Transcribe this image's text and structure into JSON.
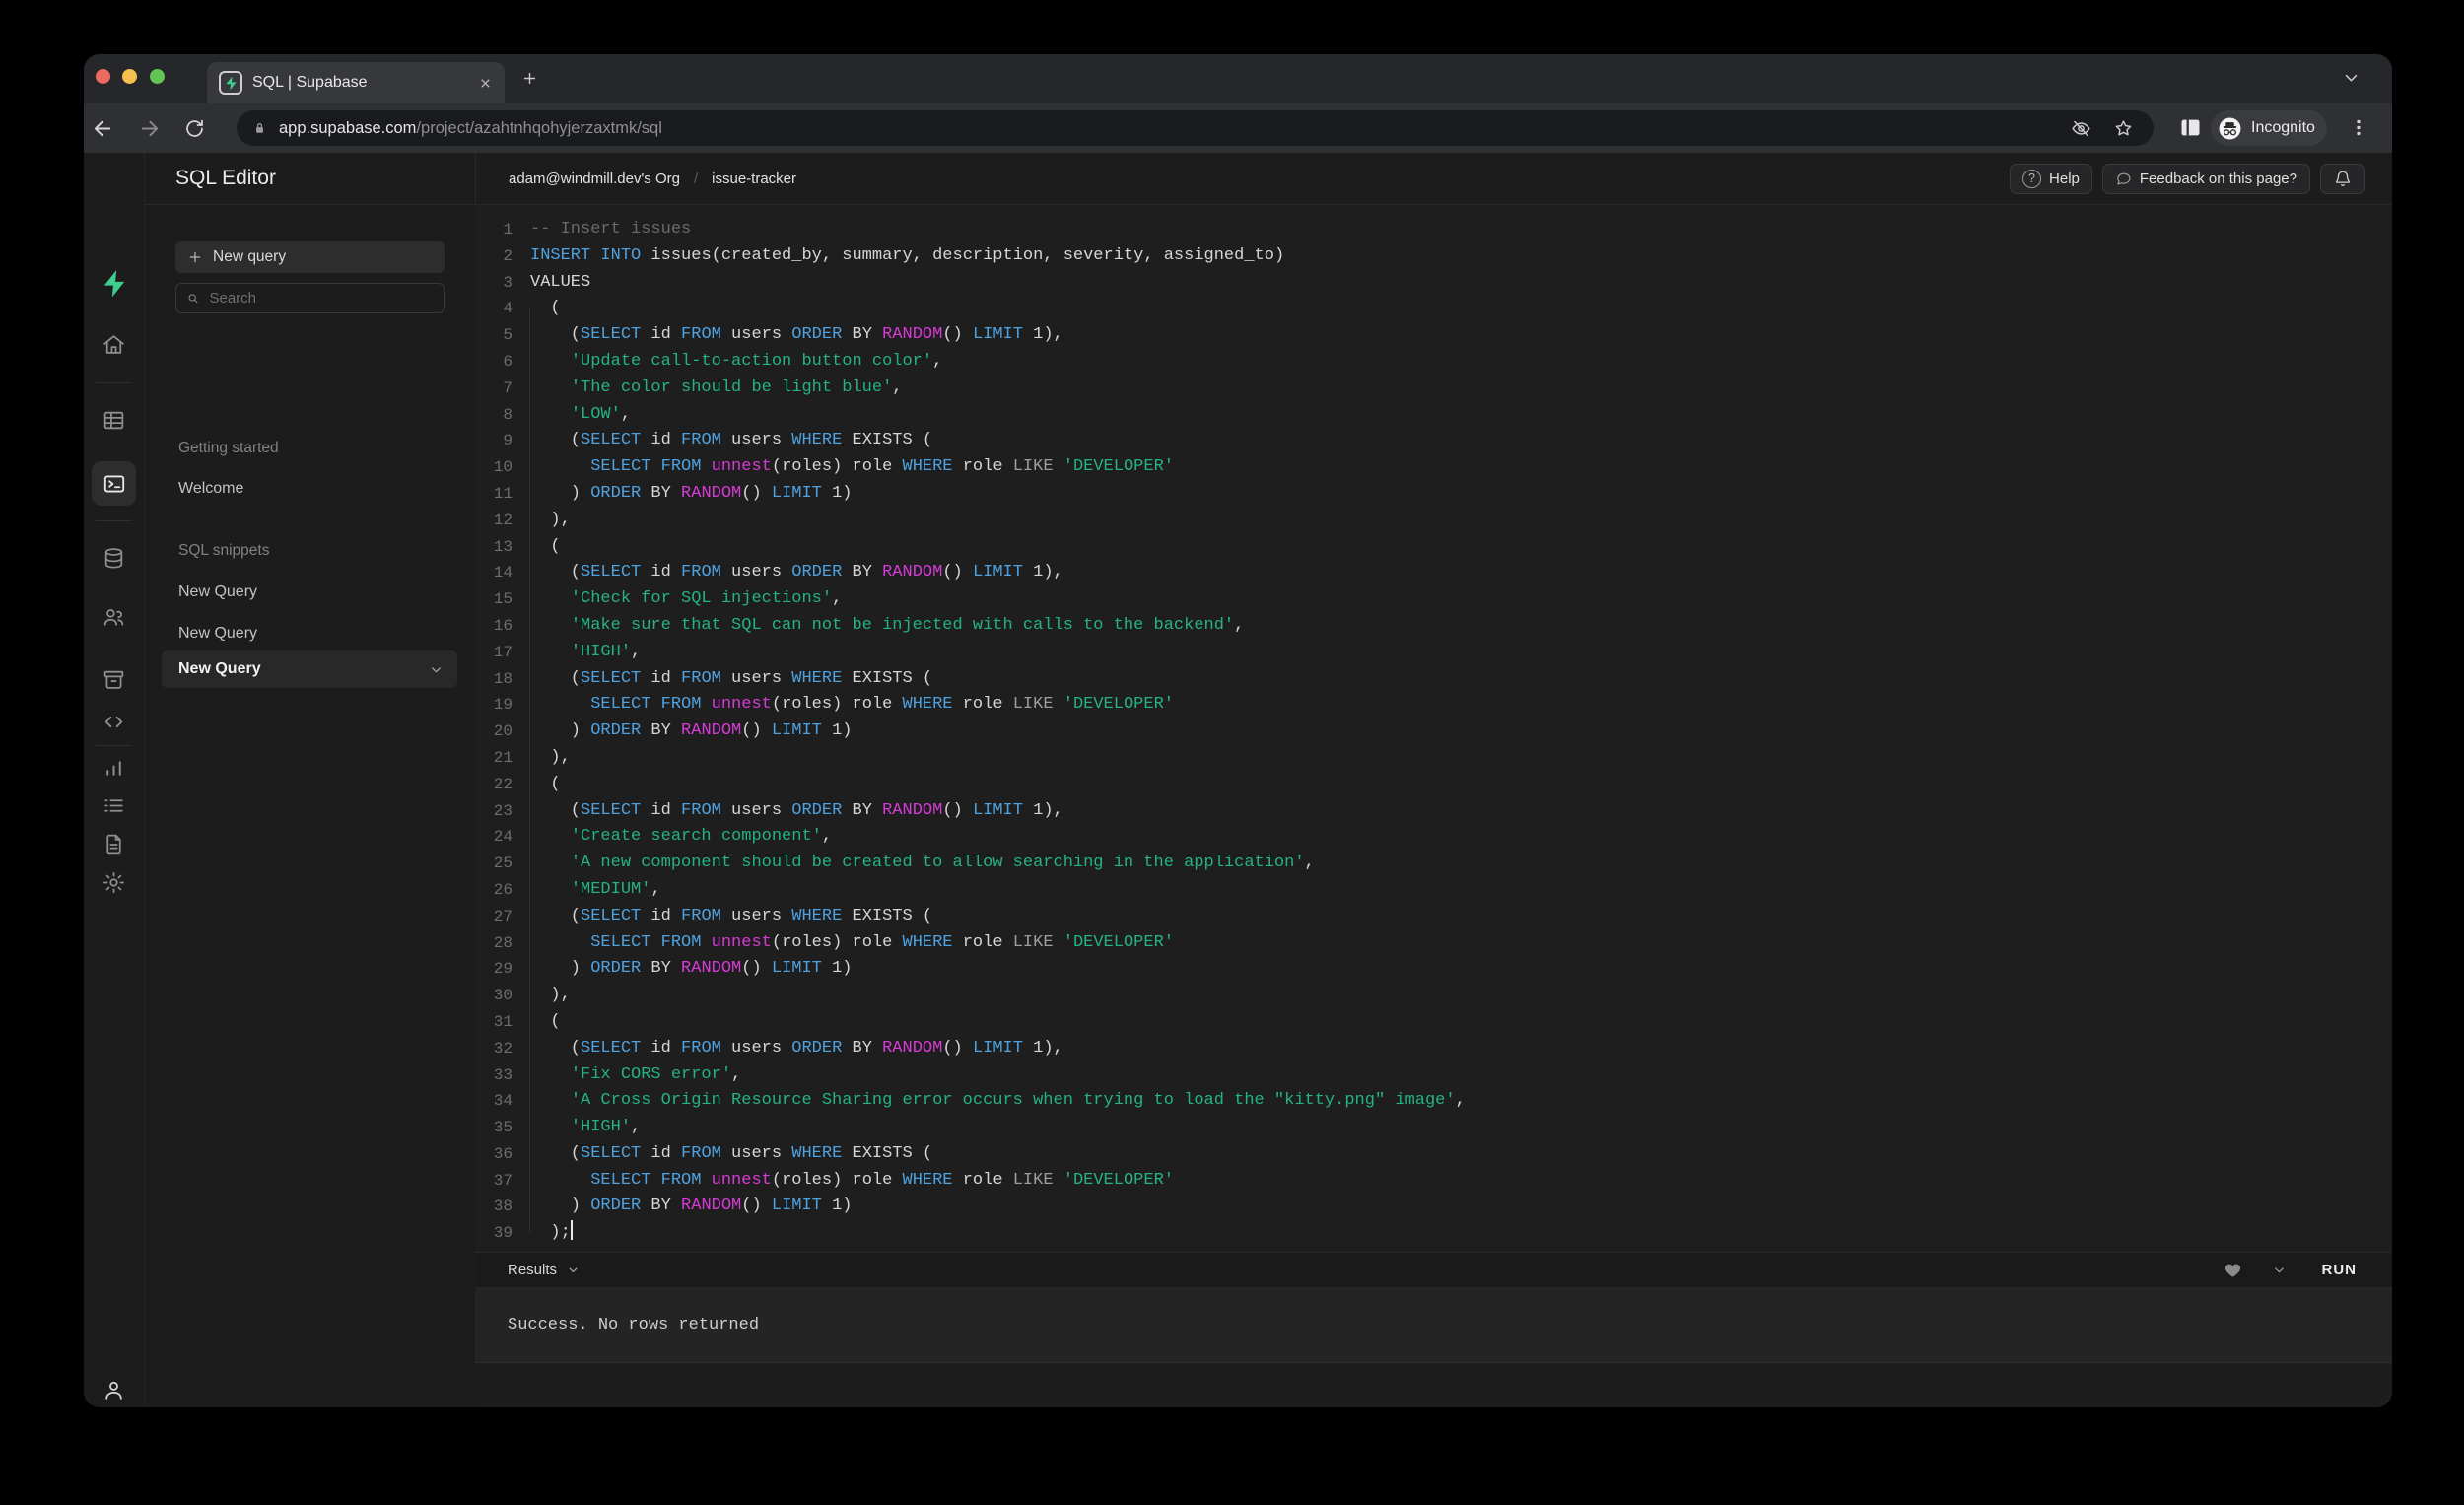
{
  "browser": {
    "tab_title": "SQL | Supabase",
    "url_host": "app.supabase.com",
    "url_path": "/project/azahtnhqohyjerzaxtmk/sql",
    "incognito_label": "Incognito"
  },
  "rail_icons": [
    "supabase-logo",
    "home",
    "table-editor",
    "sql-editor",
    "database",
    "auth-users",
    "storage",
    "edge-functions",
    "reports",
    "logs",
    "api-docs",
    "settings",
    "account"
  ],
  "panel": {
    "title": "SQL Editor",
    "new_query_label": "New query",
    "search_placeholder": "Search",
    "sections": [
      {
        "label": "Getting started",
        "items": [
          {
            "label": "Welcome"
          }
        ]
      },
      {
        "label": "SQL snippets",
        "items": [
          {
            "label": "New Query"
          },
          {
            "label": "New Query"
          },
          {
            "label": "New Query",
            "active": true
          }
        ]
      }
    ]
  },
  "header": {
    "org": "adam@windmill.dev's Org",
    "separator": "/",
    "project": "issue-tracker",
    "help_label": "Help",
    "feedback_label": "Feedback on this page?"
  },
  "editor": {
    "caret_line": 39,
    "token_colors": {
      "k": "#4fa2e0",
      "f": "#d63bd6",
      "s": "#25b284",
      "c": "#6a6a6a",
      "o": "#9e9e9e",
      "p": "#d6d6d6"
    },
    "accent_green": "#3ecf8e",
    "lines": [
      [
        [
          "c",
          "-- Insert issues"
        ]
      ],
      [
        [
          "k",
          "INSERT"
        ],
        [
          "p",
          " "
        ],
        [
          "k",
          "INTO"
        ],
        [
          "p",
          " issues(created_by, summary, description, severity, assigned_to)"
        ]
      ],
      [
        [
          "p",
          "VALUES"
        ]
      ],
      [
        [
          "p",
          "  ("
        ]
      ],
      [
        [
          "p",
          "    ("
        ],
        [
          "k",
          "SELECT"
        ],
        [
          "p",
          " id "
        ],
        [
          "k",
          "FROM"
        ],
        [
          "p",
          " users "
        ],
        [
          "k",
          "ORDER"
        ],
        [
          "p",
          " BY "
        ],
        [
          "f",
          "RANDOM"
        ],
        [
          "p",
          "() "
        ],
        [
          "k",
          "LIMIT"
        ],
        [
          "p",
          " 1),"
        ]
      ],
      [
        [
          "p",
          "    "
        ],
        [
          "s",
          "'Update call-to-action button color'"
        ],
        [
          "p",
          ","
        ]
      ],
      [
        [
          "p",
          "    "
        ],
        [
          "s",
          "'The color should be light blue'"
        ],
        [
          "p",
          ","
        ]
      ],
      [
        [
          "p",
          "    "
        ],
        [
          "s",
          "'LOW'"
        ],
        [
          "p",
          ","
        ]
      ],
      [
        [
          "p",
          "    ("
        ],
        [
          "k",
          "SELECT"
        ],
        [
          "p",
          " id "
        ],
        [
          "k",
          "FROM"
        ],
        [
          "p",
          " users "
        ],
        [
          "k",
          "WHERE"
        ],
        [
          "p",
          " EXISTS ("
        ]
      ],
      [
        [
          "p",
          "      "
        ],
        [
          "k",
          "SELECT"
        ],
        [
          "p",
          " "
        ],
        [
          "k",
          "FROM"
        ],
        [
          "p",
          " "
        ],
        [
          "f",
          "unnest"
        ],
        [
          "p",
          "(roles) role "
        ],
        [
          "k",
          "WHERE"
        ],
        [
          "p",
          " role "
        ],
        [
          "o",
          "LIKE"
        ],
        [
          "p",
          " "
        ],
        [
          "s",
          "'DEVELOPER'"
        ]
      ],
      [
        [
          "p",
          "    ) "
        ],
        [
          "k",
          "ORDER"
        ],
        [
          "p",
          " BY "
        ],
        [
          "f",
          "RANDOM"
        ],
        [
          "p",
          "() "
        ],
        [
          "k",
          "LIMIT"
        ],
        [
          "p",
          " 1)"
        ]
      ],
      [
        [
          "p",
          "  ),"
        ]
      ],
      [
        [
          "p",
          "  ("
        ]
      ],
      [
        [
          "p",
          "    ("
        ],
        [
          "k",
          "SELECT"
        ],
        [
          "p",
          " id "
        ],
        [
          "k",
          "FROM"
        ],
        [
          "p",
          " users "
        ],
        [
          "k",
          "ORDER"
        ],
        [
          "p",
          " BY "
        ],
        [
          "f",
          "RANDOM"
        ],
        [
          "p",
          "() "
        ],
        [
          "k",
          "LIMIT"
        ],
        [
          "p",
          " 1),"
        ]
      ],
      [
        [
          "p",
          "    "
        ],
        [
          "s",
          "'Check for SQL injections'"
        ],
        [
          "p",
          ","
        ]
      ],
      [
        [
          "p",
          "    "
        ],
        [
          "s",
          "'Make sure that SQL can not be injected with calls to the backend'"
        ],
        [
          "p",
          ","
        ]
      ],
      [
        [
          "p",
          "    "
        ],
        [
          "s",
          "'HIGH'"
        ],
        [
          "p",
          ","
        ]
      ],
      [
        [
          "p",
          "    ("
        ],
        [
          "k",
          "SELECT"
        ],
        [
          "p",
          " id "
        ],
        [
          "k",
          "FROM"
        ],
        [
          "p",
          " users "
        ],
        [
          "k",
          "WHERE"
        ],
        [
          "p",
          " EXISTS ("
        ]
      ],
      [
        [
          "p",
          "      "
        ],
        [
          "k",
          "SELECT"
        ],
        [
          "p",
          " "
        ],
        [
          "k",
          "FROM"
        ],
        [
          "p",
          " "
        ],
        [
          "f",
          "unnest"
        ],
        [
          "p",
          "(roles) role "
        ],
        [
          "k",
          "WHERE"
        ],
        [
          "p",
          " role "
        ],
        [
          "o",
          "LIKE"
        ],
        [
          "p",
          " "
        ],
        [
          "s",
          "'DEVELOPER'"
        ]
      ],
      [
        [
          "p",
          "    ) "
        ],
        [
          "k",
          "ORDER"
        ],
        [
          "p",
          " BY "
        ],
        [
          "f",
          "RANDOM"
        ],
        [
          "p",
          "() "
        ],
        [
          "k",
          "LIMIT"
        ],
        [
          "p",
          " 1)"
        ]
      ],
      [
        [
          "p",
          "  ),"
        ]
      ],
      [
        [
          "p",
          "  ("
        ]
      ],
      [
        [
          "p",
          "    ("
        ],
        [
          "k",
          "SELECT"
        ],
        [
          "p",
          " id "
        ],
        [
          "k",
          "FROM"
        ],
        [
          "p",
          " users "
        ],
        [
          "k",
          "ORDER"
        ],
        [
          "p",
          " BY "
        ],
        [
          "f",
          "RANDOM"
        ],
        [
          "p",
          "() "
        ],
        [
          "k",
          "LIMIT"
        ],
        [
          "p",
          " 1),"
        ]
      ],
      [
        [
          "p",
          "    "
        ],
        [
          "s",
          "'Create search component'"
        ],
        [
          "p",
          ","
        ]
      ],
      [
        [
          "p",
          "    "
        ],
        [
          "s",
          "'A new component should be created to allow searching in the application'"
        ],
        [
          "p",
          ","
        ]
      ],
      [
        [
          "p",
          "    "
        ],
        [
          "s",
          "'MEDIUM'"
        ],
        [
          "p",
          ","
        ]
      ],
      [
        [
          "p",
          "    ("
        ],
        [
          "k",
          "SELECT"
        ],
        [
          "p",
          " id "
        ],
        [
          "k",
          "FROM"
        ],
        [
          "p",
          " users "
        ],
        [
          "k",
          "WHERE"
        ],
        [
          "p",
          " EXISTS ("
        ]
      ],
      [
        [
          "p",
          "      "
        ],
        [
          "k",
          "SELECT"
        ],
        [
          "p",
          " "
        ],
        [
          "k",
          "FROM"
        ],
        [
          "p",
          " "
        ],
        [
          "f",
          "unnest"
        ],
        [
          "p",
          "(roles) role "
        ],
        [
          "k",
          "WHERE"
        ],
        [
          "p",
          " role "
        ],
        [
          "o",
          "LIKE"
        ],
        [
          "p",
          " "
        ],
        [
          "s",
          "'DEVELOPER'"
        ]
      ],
      [
        [
          "p",
          "    ) "
        ],
        [
          "k",
          "ORDER"
        ],
        [
          "p",
          " BY "
        ],
        [
          "f",
          "RANDOM"
        ],
        [
          "p",
          "() "
        ],
        [
          "k",
          "LIMIT"
        ],
        [
          "p",
          " 1)"
        ]
      ],
      [
        [
          "p",
          "  ),"
        ]
      ],
      [
        [
          "p",
          "  ("
        ]
      ],
      [
        [
          "p",
          "    ("
        ],
        [
          "k",
          "SELECT"
        ],
        [
          "p",
          " id "
        ],
        [
          "k",
          "FROM"
        ],
        [
          "p",
          " users "
        ],
        [
          "k",
          "ORDER"
        ],
        [
          "p",
          " BY "
        ],
        [
          "f",
          "RANDOM"
        ],
        [
          "p",
          "() "
        ],
        [
          "k",
          "LIMIT"
        ],
        [
          "p",
          " 1),"
        ]
      ],
      [
        [
          "p",
          "    "
        ],
        [
          "s",
          "'Fix CORS error'"
        ],
        [
          "p",
          ","
        ]
      ],
      [
        [
          "p",
          "    "
        ],
        [
          "s",
          "'A Cross Origin Resource Sharing error occurs when trying to load the \"kitty.png\" image'"
        ],
        [
          "p",
          ","
        ]
      ],
      [
        [
          "p",
          "    "
        ],
        [
          "s",
          "'HIGH'"
        ],
        [
          "p",
          ","
        ]
      ],
      [
        [
          "p",
          "    ("
        ],
        [
          "k",
          "SELECT"
        ],
        [
          "p",
          " id "
        ],
        [
          "k",
          "FROM"
        ],
        [
          "p",
          " users "
        ],
        [
          "k",
          "WHERE"
        ],
        [
          "p",
          " EXISTS ("
        ]
      ],
      [
        [
          "p",
          "      "
        ],
        [
          "k",
          "SELECT"
        ],
        [
          "p",
          " "
        ],
        [
          "k",
          "FROM"
        ],
        [
          "p",
          " "
        ],
        [
          "f",
          "unnest"
        ],
        [
          "p",
          "(roles) role "
        ],
        [
          "k",
          "WHERE"
        ],
        [
          "p",
          " role "
        ],
        [
          "o",
          "LIKE"
        ],
        [
          "p",
          " "
        ],
        [
          "s",
          "'DEVELOPER'"
        ]
      ],
      [
        [
          "p",
          "    ) "
        ],
        [
          "k",
          "ORDER"
        ],
        [
          "p",
          " BY "
        ],
        [
          "f",
          "RANDOM"
        ],
        [
          "p",
          "() "
        ],
        [
          "k",
          "LIMIT"
        ],
        [
          "p",
          " 1)"
        ]
      ],
      [
        [
          "p",
          "  );"
        ]
      ]
    ]
  },
  "results": {
    "label": "Results",
    "run_label": "RUN",
    "message": "Success. No rows returned"
  }
}
